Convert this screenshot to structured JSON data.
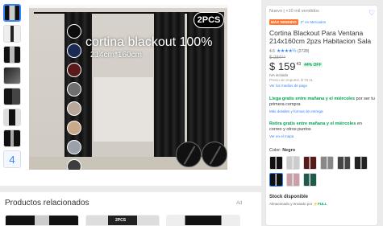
{
  "gallery": {
    "overlay_title": "cortina blackout 100%",
    "overlay_size": "214cm*160cm",
    "badge": "2PCS",
    "last_thumb_label": "4",
    "swatch_colors": [
      "#0c0c0c",
      "#1b2a55",
      "#5a1a1a",
      "#6e6e6e",
      "#b7a89a",
      "#c9a98a",
      "#9aa1a8",
      "#3d3d3d",
      "#b06a7a",
      "#1f5a4a"
    ]
  },
  "related": {
    "title": "Productos relacionados",
    "ad_label": "Ad",
    "card_tag": "2PCS"
  },
  "product": {
    "condition": "Nuevo  |  +10 mil vendidos",
    "badge_best_seller": "MÁS VENDIDO",
    "rank_link": "2º en Mercados",
    "title": "Cortina Blackout Para Ventana 214x160cm 2pzs Habitacion Sala",
    "rating": "4.6",
    "stars": "★★★★½",
    "review_count": "(2728)",
    "old_price": "$ 284⁹⁹",
    "price": "$ 159",
    "price_cents": "43",
    "discount": "44% OFF",
    "iva": "IVA incluido",
    "no_tax_price": "Precio sin impuest. $ 78.11",
    "payment_link": "Ver los medios de pago",
    "shipping1_green": "Llega gratis entre mañana y el miércoles",
    "shipping1_rest": " por ser tu primera compra",
    "shipping1_link": "Más detalles y formas de entrega",
    "shipping2_green": "Retira gratis entre mañana y el miércoles",
    "shipping2_rest": " en correo y otros puntos",
    "shipping2_link": "Ver en el mapa",
    "color_label": "Color:",
    "color_value": "Negro",
    "stock": "Stock disponible",
    "stock_sub": "Almacenado y enviado por",
    "full_label": "⚡FULL"
  },
  "colors": {
    "accent": "#3483fa",
    "green": "#00a650",
    "orange": "#ff7733"
  }
}
